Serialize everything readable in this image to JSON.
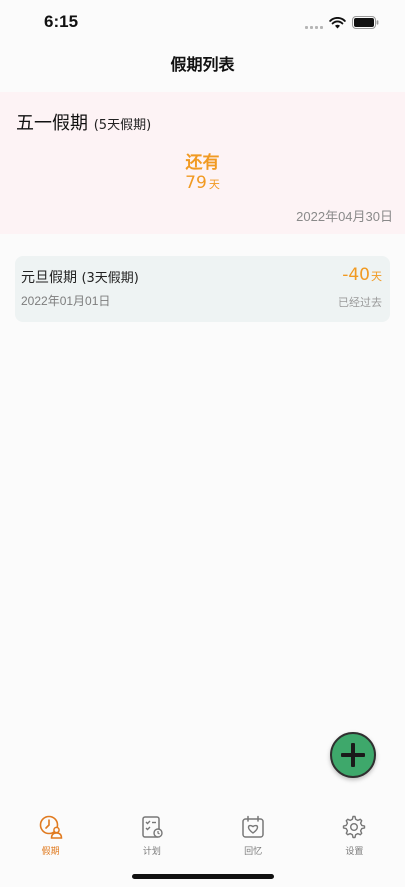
{
  "status_bar": {
    "time": "6:15"
  },
  "nav": {
    "title": "假期列表"
  },
  "featured": {
    "name": "五一假期",
    "duration": "(5天假期)",
    "remain_label": "还有",
    "count": "79",
    "unit": "天",
    "date": "2022年04月30日"
  },
  "holidays": [
    {
      "name": "元旦假期",
      "duration": "(3天假期)",
      "date": "2022年01月01日",
      "count": "-40",
      "unit": "天",
      "status": "已经过去"
    }
  ],
  "tabs": [
    {
      "label": "假期",
      "icon": "holiday-clock-person-icon",
      "active": true
    },
    {
      "label": "计划",
      "icon": "plan-checklist-icon",
      "active": false
    },
    {
      "label": "回忆",
      "icon": "memory-calendar-heart-icon",
      "active": false
    },
    {
      "label": "设置",
      "icon": "settings-gear-icon",
      "active": false
    }
  ],
  "colors": {
    "accent_orange": "#f19a22",
    "active_tab": "#e07a1f",
    "fab_green": "#3ea86b",
    "featured_bg": "#fdf3f5",
    "item_bg": "#eef3f3"
  }
}
